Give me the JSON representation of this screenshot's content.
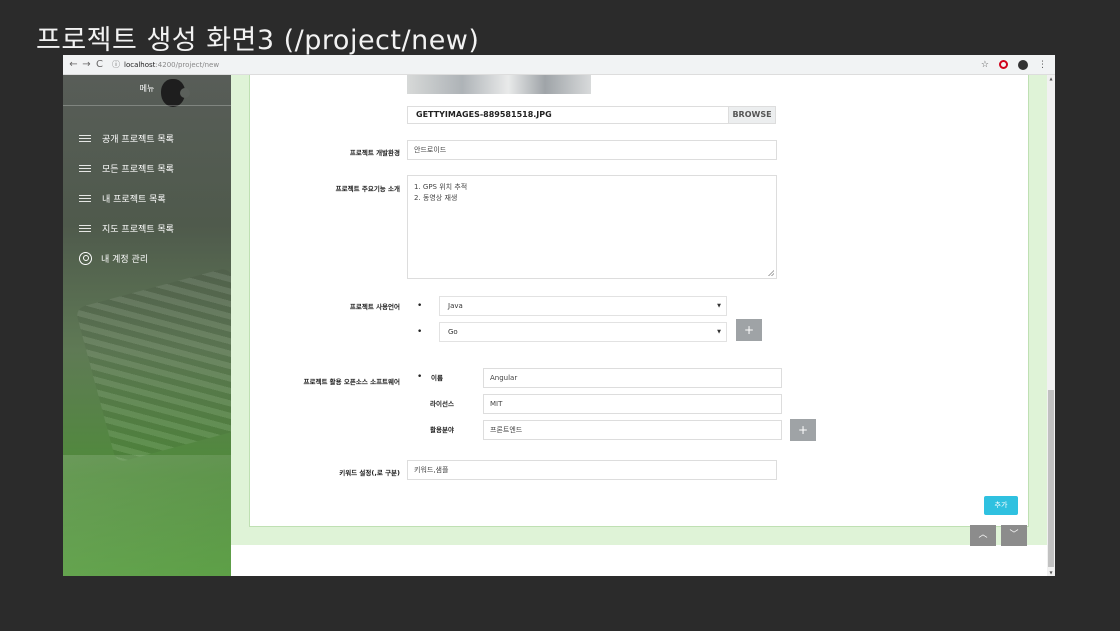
{
  "slide": {
    "title": "프로젝트 생성 화면3 (/project/new)"
  },
  "browser": {
    "url_host": "localhost",
    "url_path": ":4200/project/new",
    "back": "←",
    "forward": "→",
    "reload": "C",
    "info": "ⓘ",
    "star": "☆",
    "menu": "⋮"
  },
  "sidebar": {
    "title": "메뉴",
    "items": [
      {
        "label": "공개 프로젝트 목록",
        "icon": "list-icon"
      },
      {
        "label": "모든 프로젝트 목록",
        "icon": "list-icon"
      },
      {
        "label": "내 프로젝트 목록",
        "icon": "list-icon"
      },
      {
        "label": "지도 프로젝트 목록",
        "icon": "list-icon"
      },
      {
        "label": "내 계정 관리",
        "icon": "user-circle-icon"
      }
    ]
  },
  "form": {
    "file_name": "GETTYIMAGES-889581518.JPG",
    "browse_label": "BROWSE",
    "dev_env_label": "프로젝트 개발환경",
    "dev_env_value": "안드로이드",
    "features_label": "프로젝트 주요기능 소개",
    "features_lines": [
      "1. GPS 위치 추적",
      "2. 동영상 재생"
    ],
    "languages_label": "프로젝트 사용언어",
    "languages": [
      "Java",
      "Go"
    ],
    "oss_label": "프로젝트 활용 오픈소스 소프트웨어",
    "oss_name_label": "이름",
    "oss_name_value": "Angular",
    "oss_license_label": "라이선스",
    "oss_license_value": "MIT",
    "oss_field_label": "활용분야",
    "oss_field_value": "프론트엔드",
    "keywords_label": "키워드 설정(,로 구분)",
    "keywords_value": "키워드,샘플",
    "plus": "+",
    "add_label": "추가",
    "scroll_up": "︿",
    "scroll_down": "﹀",
    "bullet": "•",
    "caret": "▼"
  }
}
